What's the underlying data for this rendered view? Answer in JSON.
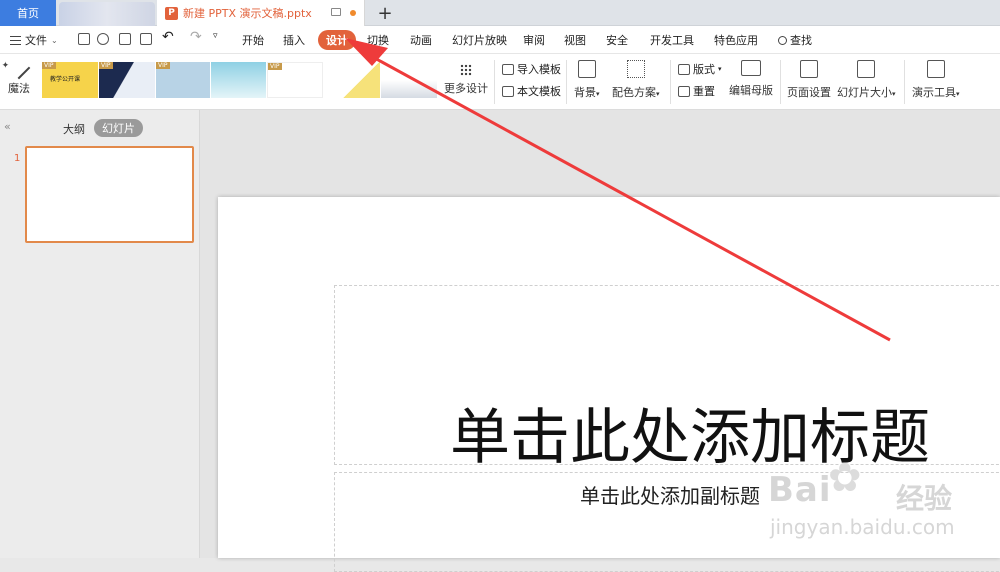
{
  "tabs": {
    "home": "首页",
    "document": "新建 PPTX 演示文稿.pptx",
    "doc_icon": "P",
    "add": "+"
  },
  "menu": {
    "file": "文件",
    "items": [
      "开始",
      "插入",
      "设计",
      "切换",
      "动画",
      "幻灯片放映",
      "审阅",
      "视图",
      "安全",
      "开发工具",
      "特色应用"
    ],
    "search": "查找",
    "active": "设计"
  },
  "ribbon": {
    "magic": "魔法",
    "vip": "VIP",
    "thumb1_text": "教学公开课",
    "more_design": "更多设计",
    "import_template": "导入模板",
    "this_template": "本文模板",
    "background": "背景",
    "color_scheme": "配色方案",
    "layout": "版式",
    "reset": "重置",
    "edit_master": "编辑母版",
    "page_setup": "页面设置",
    "slide_size": "幻灯片大小",
    "present_tools": "演示工具"
  },
  "left_panel": {
    "outline_tab": "大纲",
    "slides_tab": "幻灯片",
    "collapse": "«",
    "slide_number": "1"
  },
  "slide": {
    "title_placeholder": "单击此处添加标题",
    "subtitle_placeholder": "单击此处添加副标题"
  },
  "watermark": {
    "brand": "Bai",
    "brand2": "经验",
    "url": "jingyan.baidu.com"
  },
  "colors": {
    "accent": "#e2623b",
    "home_tab": "#3d7de0",
    "arrow": "#ee3b3b"
  }
}
